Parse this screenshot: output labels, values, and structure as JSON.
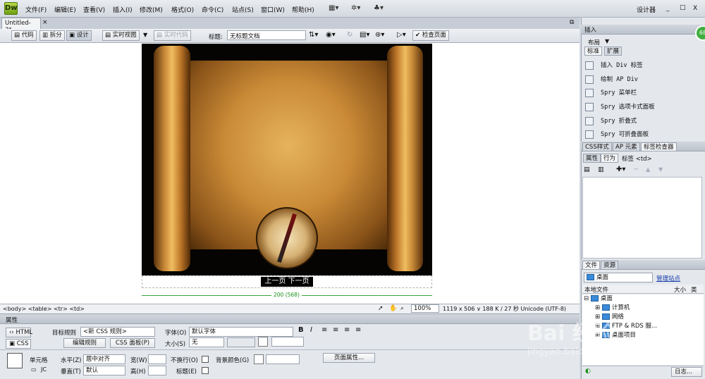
{
  "app": {
    "logo": "Dw",
    "workspace": "设计器",
    "win_min": "_",
    "win_max": "□",
    "win_close": "X"
  },
  "menu": [
    "文件(F)",
    "编辑(E)",
    "查看(V)",
    "插入(I)",
    "修改(M)",
    "格式(O)",
    "命令(C)",
    "站点(S)",
    "窗口(W)",
    "帮助(H)"
  ],
  "doc": {
    "tab": "Untitled-3*",
    "close": "×"
  },
  "doctoolbar": {
    "code": "代码",
    "split": "拆分",
    "design": "设计",
    "live_view": "实时视图",
    "live_code": "实时代码",
    "title_label": "标题:",
    "title_value": "无标题文档",
    "check_page": "检查页面"
  },
  "canvas": {
    "nav_text": "上一页 下一页",
    "width_label": "200 (568)"
  },
  "statusbar": {
    "tags": "<body> <table> <tr> <td>",
    "zoom": "100%",
    "info": "1119 x 506 ∨ 188 K / 27 秒 Unicode (UTF-8)"
  },
  "props": {
    "title": "属性",
    "html_btn": "HTML",
    "css_btn": "CSS",
    "target_rule_label": "目标规则",
    "target_rule_value": "<新 CSS 规则>",
    "edit_rule": "编辑规则",
    "css_panel": "CSS 面板(P)",
    "font_label": "字体(O)",
    "font_value": "默认字体",
    "size_label": "大小(S)",
    "size_value": "无",
    "bold": "B",
    "italic": "I",
    "cell_label": "单元格",
    "horz_label": "水平(Z)",
    "horz_value": "居中对齐",
    "vert_label": "垂直(T)",
    "vert_value": "默认",
    "width_label": "宽(W)",
    "height_label": "高(H)",
    "nowrap_label": "不换行(O)",
    "bg_label": "背景颜色(G)",
    "header_label": "标题(E)",
    "page_props": "页面属性...",
    "jc": "JC"
  },
  "insert_panel": {
    "header": "插入",
    "category": "布局",
    "tab_std": "标准",
    "tab_ext": "扩展",
    "items": [
      "插入 Div 标签",
      "绘制 AP Div",
      "Spry 菜单栏",
      "Spry 选项卡式面板",
      "Spry 折叠式",
      "Spry 可折叠面板"
    ]
  },
  "tag_panel": {
    "tabs": [
      "CSS样式",
      "AP 元素",
      "标签检查器"
    ],
    "sub_tabs": [
      "属性",
      "行为"
    ],
    "tag_label": "标签 <td>"
  },
  "files_panel": {
    "tabs": [
      "文件",
      "资源"
    ],
    "location": "桌面",
    "manage": "管理站点",
    "col_local": "本地文件",
    "col_size": "大小",
    "col_type": "类",
    "tree": [
      "桌面",
      "计算机",
      "网络",
      "FTP & RDS 服...",
      "桌面项目"
    ],
    "log": "日志..."
  },
  "badge": "68",
  "watermark": "Bai 经验",
  "watermark_url": "jingyan.baidu.com"
}
